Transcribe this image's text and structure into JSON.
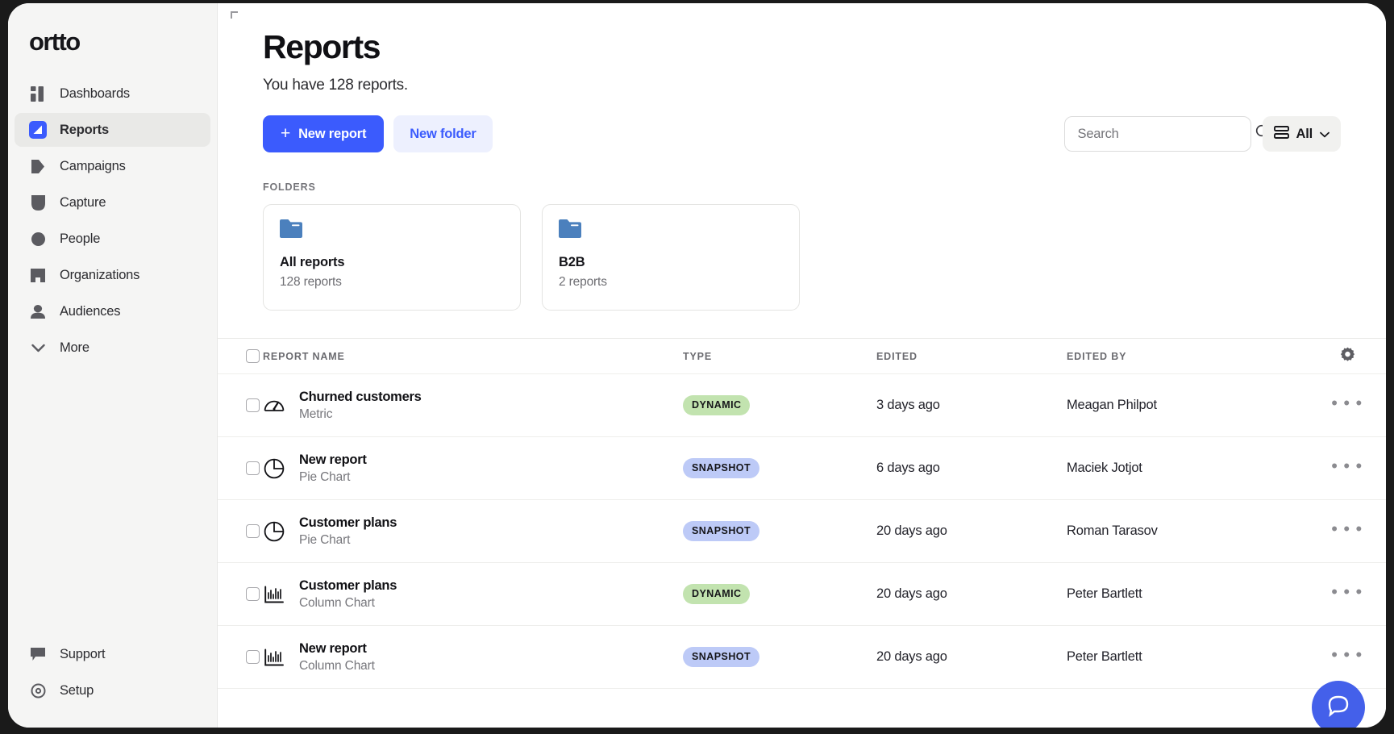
{
  "sidebar": {
    "logo_text": "ortto",
    "items": [
      {
        "label": "Dashboards",
        "icon": "dashboard-icon",
        "active": false
      },
      {
        "label": "Reports",
        "icon": "reports-icon",
        "active": true
      },
      {
        "label": "Campaigns",
        "icon": "campaigns-icon",
        "active": false
      },
      {
        "label": "Capture",
        "icon": "capture-icon",
        "active": false
      },
      {
        "label": "People",
        "icon": "people-icon",
        "active": false
      },
      {
        "label": "Organizations",
        "icon": "organizations-icon",
        "active": false
      },
      {
        "label": "Audiences",
        "icon": "audiences-icon",
        "active": false
      },
      {
        "label": "More",
        "icon": "chevron-down-icon",
        "active": false
      }
    ],
    "bottom_items": [
      {
        "label": "Support",
        "icon": "support-icon"
      },
      {
        "label": "Setup",
        "icon": "setup-icon"
      }
    ]
  },
  "header": {
    "title": "Reports",
    "subtitle": "You have 128 reports.",
    "new_report_label": "New report",
    "new_report_plus": "+",
    "new_folder_label": "New folder"
  },
  "search": {
    "placeholder": "Search",
    "value": "",
    "icon": "search-icon"
  },
  "filter": {
    "label": "All",
    "icon": "list-view-icon",
    "chevron": "chevron-down-icon"
  },
  "folders": {
    "section_label": "FOLDERS",
    "items": [
      {
        "name": "All reports",
        "count": "128 reports",
        "icon": "folder-icon"
      },
      {
        "name": "B2B",
        "count": "2 reports",
        "icon": "folder-icon"
      }
    ]
  },
  "table": {
    "columns": {
      "name": "REPORT NAME",
      "type": "TYPE",
      "edited": "EDITED",
      "edited_by": "EDITED BY",
      "settings_icon": "gear-icon"
    },
    "rows": [
      {
        "title": "Churned customers",
        "subtitle": "Metric",
        "icon": "gauge-icon",
        "badge": "DYNAMIC",
        "badge_kind": "dynamic",
        "edited": "3 days ago",
        "edited_by": "Meagan Philpot",
        "menu": "• • •"
      },
      {
        "title": "New report",
        "subtitle": "Pie Chart",
        "icon": "pie-chart-icon",
        "badge": "SNAPSHOT",
        "badge_kind": "snapshot",
        "edited": "6 days ago",
        "edited_by": "Maciek Jotjot",
        "menu": "• • •"
      },
      {
        "title": "Customer plans",
        "subtitle": "Pie Chart",
        "icon": "pie-chart-icon",
        "badge": "SNAPSHOT",
        "badge_kind": "snapshot",
        "edited": "20 days ago",
        "edited_by": "Roman Tarasov",
        "menu": "• • •"
      },
      {
        "title": "Customer plans",
        "subtitle": "Column Chart",
        "icon": "column-chart-icon",
        "badge": "DYNAMIC",
        "badge_kind": "dynamic",
        "edited": "20 days ago",
        "edited_by": "Peter Bartlett",
        "menu": "• • •"
      },
      {
        "title": "New report",
        "subtitle": "Column Chart",
        "icon": "column-chart-icon",
        "badge": "SNAPSHOT",
        "badge_kind": "snapshot",
        "edited": "20 days ago",
        "edited_by": "Peter Bartlett",
        "menu": "• • •"
      }
    ]
  },
  "fab": {
    "icon": "chat-bubble-icon"
  },
  "colors": {
    "accent": "#3b5bfd",
    "accent_soft": "#edf0fe",
    "sidebar_bg": "#f5f5f4",
    "badge_dynamic": "#c2e3af",
    "badge_snapshot": "#bdcaf7",
    "folder_icon": "#4b80bd",
    "fab": "#4460ea"
  }
}
